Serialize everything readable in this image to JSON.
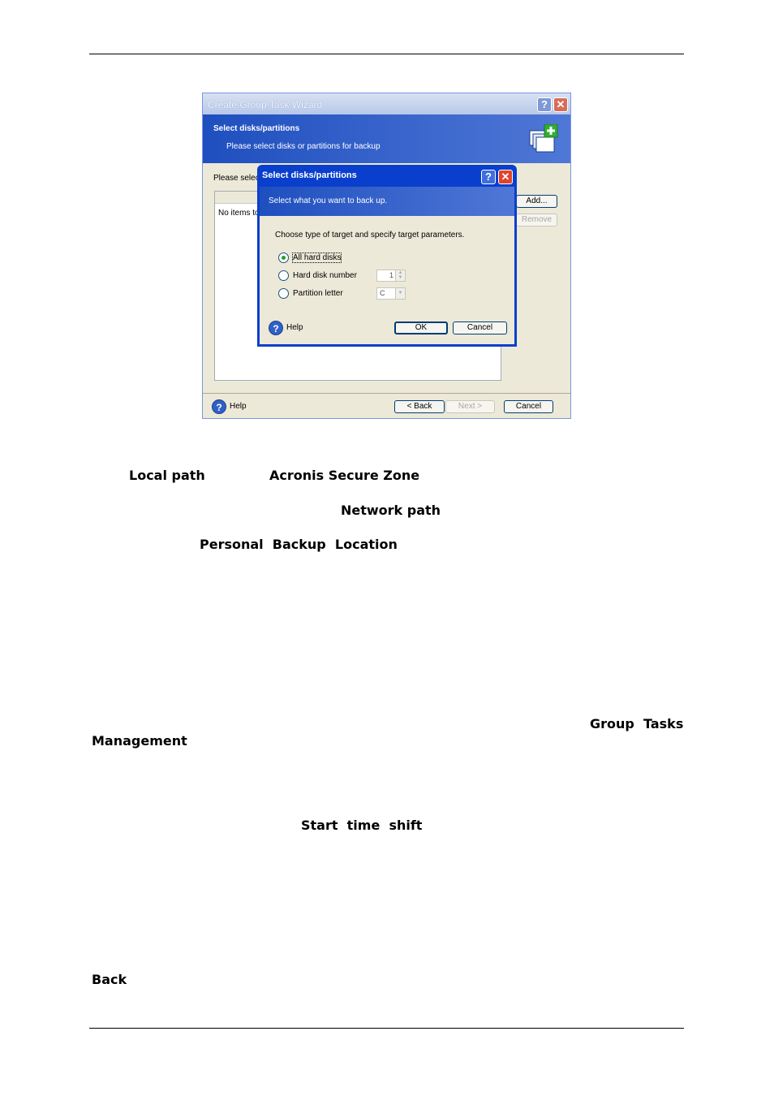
{
  "wizard": {
    "title": "Create Group Task Wizard",
    "help_btn": "?",
    "close_btn": "✕",
    "header_title": "Select disks/partitions",
    "header_subtitle": "Please select disks or partitions for backup",
    "body_label": "Please select",
    "list_empty": "No items to",
    "add_label": "Add...",
    "remove_label": "Remove",
    "help_label": "Help",
    "back_label": "< Back",
    "next_label": "Next >",
    "cancel_label": "Cancel"
  },
  "dialog": {
    "title": "Select disks/partitions",
    "help_btn": "?",
    "close_btn": "✕",
    "header_subtitle": "Select what you want to back up.",
    "instruction": "Choose type of target and specify target parameters.",
    "options": [
      {
        "label": "All hard disks",
        "selected": true
      },
      {
        "label": "Hard disk number",
        "value": "1"
      },
      {
        "label": "Partition letter",
        "value": "C"
      }
    ],
    "help_label": "Help",
    "ok_label": "OK",
    "cancel_label": "Cancel"
  },
  "text": {
    "local_path": "Local path",
    "acronis_secure_zone": "Acronis Secure Zone",
    "network_path": "Network path",
    "personal_backup_location": "Personal  Backup  Location",
    "group_tasks": "Group  Tasks",
    "management": "Management",
    "start_time_shift": "Start  time  shift",
    "back": "Back"
  }
}
